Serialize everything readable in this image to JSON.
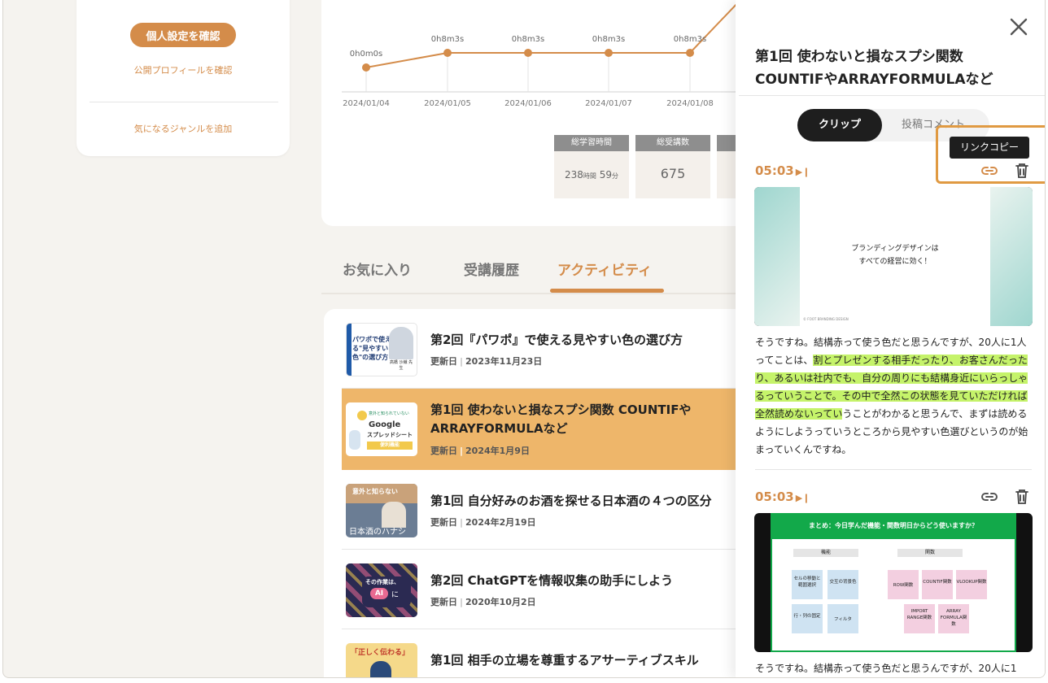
{
  "profile": {
    "settings_button": "個人設定を確認",
    "public_profile_link": "公開プロフィールを確認",
    "genre_link": "気になるジャンルを追加"
  },
  "chart_data": {
    "type": "line",
    "x": [
      "2024/01/04",
      "2024/01/05",
      "2024/01/06",
      "2024/01/07",
      "2024/01/08"
    ],
    "point_labels": [
      "0h0m0s",
      "0h8m3s",
      "0h8m3s",
      "0h8m3s",
      "0h8m3s"
    ],
    "series": [
      {
        "values": [
          0,
          483,
          483,
          483,
          483
        ]
      }
    ],
    "color": "#d48c4a"
  },
  "stats": [
    {
      "label": "総学習時間",
      "value_main": "238",
      "value_unit1": "時間",
      "value_min": "59",
      "value_unit2": "分"
    },
    {
      "label": "総受講数",
      "value": "675"
    }
  ],
  "tabs": [
    {
      "label": "お気に入り"
    },
    {
      "label": "受講履歴"
    },
    {
      "label": "アクティビティ"
    }
  ],
  "courses": [
    {
      "title": "第2回『パワポ』で使える見やすい色の選び方",
      "date_label": "更新日",
      "date": "2023年11月23日",
      "thumb_text": "パワポで使える\"見やすい色\"の選び方",
      "thumb_author": "高橋 沙織 先生"
    },
    {
      "title": "第1回 使わないと損なスプシ関数 COUNTIFや ARRAYFORMULAなど",
      "date_label": "更新日",
      "date": "2024年1月9日",
      "thumb_text": "意外と知られていない",
      "thumb_brand": "Google",
      "thumb_sub": "スプレッドシート",
      "thumb_tag": "便利機能"
    },
    {
      "title": "第1回 自分好みのお酒を探せる日本酒の４つの区分",
      "date_label": "更新日",
      "date": "2024年2月19日",
      "thumb_text": "意外と知らない",
      "thumb_sub": "日本酒のハナシ"
    },
    {
      "title": "第2回 ChatGPTを情報収集の助手にしよう",
      "date_label": "更新日",
      "date": "2020年10月2日",
      "thumb_text": "その作業は、",
      "thumb_ai": "AI",
      "thumb_ni": "に"
    },
    {
      "title": "第1回 相手の立場を尊重するアサーティブスキル",
      "thumb_text": "「正しく伝わる」"
    }
  ],
  "panel": {
    "title": "第1回 使わないと損なスプシ関数 COUNTIFやARRAYFORMULAなど",
    "toggle_clip": "クリップ",
    "toggle_comment": "投稿コメント",
    "tooltip": "リンクコピー",
    "clips": [
      {
        "time": "05:03",
        "slide_line1": "ブランディングデザインは",
        "slide_line2": "すべての経営に効く！",
        "slide_footer": "© FOOT BRANDING DESIGN",
        "text_before": "そうですね。結構赤って使う色だと思うんですが、20人に1人ってことは、",
        "text_highlight": "割とプレゼンする相手だったり、お客さんだったり、あるいは社内でも、自分の周りにも結構身近にいらっしゃるっていうことで。その中で全然この状態を見ていただければ全然読めないってい",
        "text_after": "うことがわかると思うんで、まずは読めるようにしようっていうところから見やすい色選びというのが始まっていくんですね。"
      },
      {
        "time": "05:03",
        "slide_title": "まとめ：今日学んだ機能・関数明日からどう使いますか？",
        "group_left": "機能",
        "group_right": "関数",
        "notes_left": [
          "セルの移動と範囲選択",
          "交互の背景色",
          "行・列の固定",
          "フィルタ"
        ],
        "notes_right": [
          "ROW関数",
          "COUNTIF関数",
          "VLOOKUP関数",
          "IMPORT RANGE関数",
          "ARRAY FORMULA関数"
        ],
        "text_before": "そうですね。結構赤って使う色だと思うんですが、20人に1"
      }
    ]
  }
}
